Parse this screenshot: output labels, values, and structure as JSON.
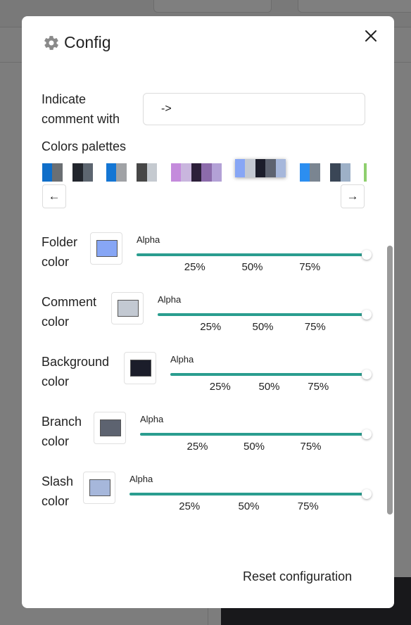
{
  "modal": {
    "title": "Config",
    "close_icon": "close-icon",
    "reset_label": "Reset configuration"
  },
  "comment": {
    "label_line1": "Indicate",
    "label_line2": "comment with",
    "value": "->"
  },
  "palettes": {
    "label": "Colors palettes",
    "prev_label": "←",
    "next_label": "→",
    "items": [
      {
        "colors": [
          "#0f6ec9",
          "#6b6f73",
          "#ffffff",
          "#22262d",
          "#5d6670"
        ]
      },
      {
        "colors": [
          "#1476d4",
          "#a0a2a5",
          "#ffffff",
          "#474747",
          "#c5cad0"
        ]
      },
      {
        "colors": [
          "#c48bdc",
          "#c9b6de",
          "#2c1f3a",
          "#8c6bab",
          "#b3a1d6"
        ]
      },
      {
        "colors": [
          "#87a6f5",
          "#c3c9d2",
          "#1b1d2a",
          "#5d6370",
          "#a6b7db"
        ],
        "selected": true
      },
      {
        "colors": [
          "#2c8ef0",
          "#7a8591",
          "#ffffff",
          "#3a4656",
          "#9db0c7"
        ]
      },
      {
        "colors": [
          "#8fcf6e"
        ]
      }
    ]
  },
  "color_settings": [
    {
      "label_line1": "Folder",
      "label_line2": "color",
      "swatch": "#87a6f5",
      "alpha_label": "Alpha",
      "alpha": 1.0,
      "ticks": [
        "25%",
        "50%",
        "75%"
      ]
    },
    {
      "label_line1": "Comment",
      "label_line2": "color",
      "swatch": "#c3c9d2",
      "alpha_label": "Alpha",
      "alpha": 1.0,
      "ticks": [
        "25%",
        "50%",
        "75%"
      ]
    },
    {
      "label_line1": "Background",
      "label_line2": "color",
      "swatch": "#1b1d2a",
      "alpha_label": "Alpha",
      "alpha": 1.0,
      "ticks": [
        "25%",
        "50%",
        "75%"
      ]
    },
    {
      "label_line1": "Branch",
      "label_line2": "color",
      "swatch": "#5d6370",
      "alpha_label": "Alpha",
      "alpha": 1.0,
      "ticks": [
        "25%",
        "50%",
        "75%"
      ]
    },
    {
      "label_line1": "Slash",
      "label_line2": "color",
      "swatch": "#a6b7db",
      "alpha_label": "Alpha",
      "alpha": 1.0,
      "ticks": [
        "25%",
        "50%",
        "75%"
      ]
    }
  ],
  "colors": {
    "slider_track": "#2a9d8f",
    "gear": "#8a8a8a"
  }
}
